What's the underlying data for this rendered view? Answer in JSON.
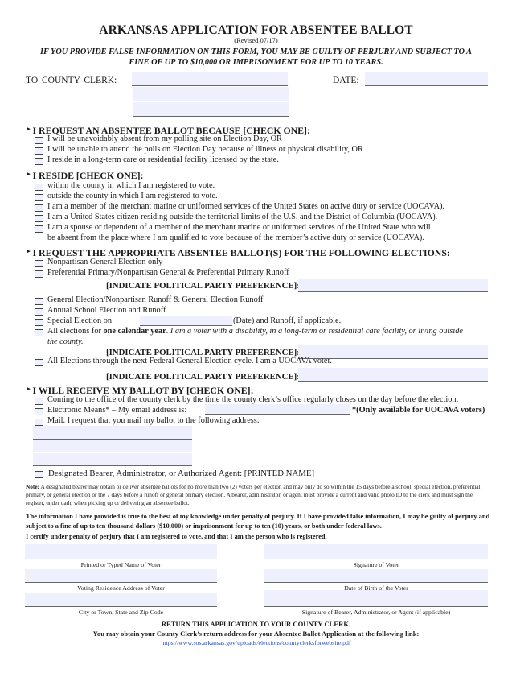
{
  "header": {
    "title": "ARKANSAS APPLICATION FOR ABSENTEE BALLOT",
    "revised": "(Revised 07/17)",
    "warning_line1": "IF YOU PROVIDE FALSE INFORMATION ON THIS FORM, YOU MAY BE GUILTY OF PERJURY AND SUBJECT TO A",
    "warning_line2": "FINE OF UP TO $10,000 OR IMPRISONMENT FOR UP TO 10 YEARS."
  },
  "addressee": {
    "county_clerk_label": "TO  COUNTY  CLERK:",
    "county_clerk_lines": [
      "",
      "",
      ""
    ],
    "date_label": "DATE:",
    "date_value": ""
  },
  "section_reason": {
    "heading": "I REQUEST AN ABSENTEE BALLOT BECAUSE [CHECK ONE]:",
    "options": [
      "I will be unavoidably absent from my polling site on Election Day, OR",
      "I will be unable to attend the polls on Election Day because of illness or physical disability, OR",
      "I reside in a long-term care or residential facility licensed by the state."
    ]
  },
  "section_reside": {
    "heading": "I RESIDE [CHECK ONE]:",
    "options": [
      "within the county in which I am registered to vote.",
      "outside the county in which I am registered to vote.",
      "I am a member of the merchant marine or uniformed services of the United States on active duty or service (UOCAVA).",
      "I am a United States citizen residing outside the territorial limits of the U.S. and the District of Columbia (UOCAVA).",
      "I am a spouse or dependent of a member of the merchant marine or uniformed services of the United State who will"
    ],
    "option5_cont": "be absent from the place where I am qualified to vote because of the member’s active duty or service (UOCAVA)."
  },
  "section_elections": {
    "heading": "I REQUEST THE APPROPRIATE ABSENTEE BALLOT(S) FOR THE FOLLOWING ELECTIONS:",
    "opt_nonpartisan": "Nonpartisan General Election only",
    "opt_preferential": "Preferential Primary/Nonpartisan General & Preferential Primary Runoff",
    "party_label": "[INDICATE POLITICAL PARTY PREFERENCE]:",
    "opt_general": "General Election/Nonpartisan Runoff  & General Election Runoff",
    "opt_school": "Annual School Election and Runoff",
    "opt_special_prefix": "Special Election on",
    "opt_special_suffix": "(Date) and Runoff, if applicable.",
    "opt_calendar_prefix": "All elections for ",
    "opt_calendar_bold": "one calendar year",
    "opt_calendar_dot": ". ",
    "opt_calendar_italic": "I am a voter with a disability, in a long-term or residential care facility, or living outside",
    "opt_calendar_italic_cont": "the county.",
    "opt_federal": "All Elections through the next Federal General Election cycle. I am a UOCAVA voter.",
    "party_values": [
      "",
      "",
      ""
    ],
    "special_date_value": ""
  },
  "section_receive": {
    "heading": "I WILL RECEIVE MY BALLOT BY [CHECK ONE]:",
    "opt_office": "Coming to the office of the county clerk by the time the county clerk’s office regularly closes on the day before the election.",
    "opt_email_prefix": "Electronic Means* – My email address is:",
    "opt_email_note": "*(Only available for UOCAVA voters)",
    "opt_mail": "Mail. I request that you mail my ballot to the following address:",
    "email_value": "",
    "mail_address_lines": [
      "",
      "",
      ""
    ],
    "opt_bearer": "Designated Bearer, Administrator, or Authorized Agent:  [PRINTED NAME]"
  },
  "note": {
    "label": "Note:",
    "text": " A designated bearer may obtain or deliver absentee ballots for no more than two (2) voters per election and may only do so within the 15 days before a school, special election, preferential primary, or general election or the 7 days before a runoff or general primary election. A bearer, administrator, or agent must provide a current and valid photo ID to the clerk and must sign the register, under oath, when picking up or delivering an absentee ballot."
  },
  "certification": {
    "perjury_text": "The information I have provided is true to the best of my knowledge under penalty of perjury. If I have provided false information, I may be guilty of perjury and subject to a fine of up to ten thousand dollars ($10,000) or imprisonment for up to ten (10) years, or both under federal laws.",
    "certify_text": "I certify under penalty of perjury that I am registered to vote, and that I am the person who is registered."
  },
  "signature_fields": {
    "left": [
      {
        "caption": "Printed or Typed Name of Voter",
        "value": ""
      },
      {
        "caption": "Voting Residence Address of Voter",
        "value": ""
      },
      {
        "caption": "City or Town, State and Zip Code",
        "value": ""
      }
    ],
    "right": [
      {
        "caption": "Signature of Voter",
        "value": ""
      },
      {
        "caption": "Date of Birth of the Voter",
        "value": ""
      },
      {
        "caption": "Signature of Bearer, Administrator, or Agent (if applicable)",
        "value": ""
      }
    ]
  },
  "footer": {
    "return_text": "RETURN THIS APPLICATION TO YOUR COUNTY CLERK.",
    "obtain_text": "You may obtain your County Clerk’s return address for your Absentee Ballot Application at the following link:",
    "link": "https://www.sos.arkansas.gov/uploads/elections/countyclerksforwebsite.pdf"
  },
  "colors": {
    "field_fill": "#eef1fd",
    "link": "#2a4fb3",
    "text": "#1a1a1a"
  }
}
